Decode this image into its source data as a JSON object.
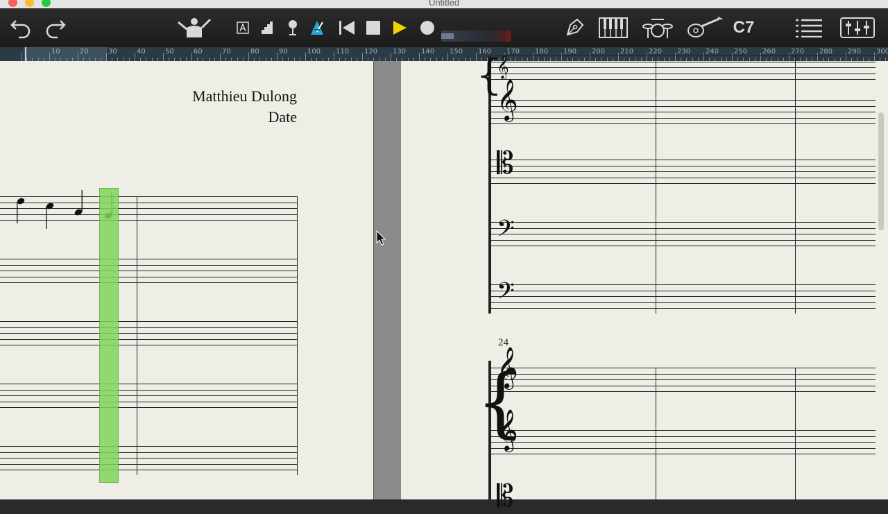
{
  "window": {
    "title": "Untitled"
  },
  "toolbar": {
    "chord_symbol": "C7",
    "meter_level": 0.18
  },
  "ruler": {
    "labels": [
      "10",
      "20",
      "30",
      "40",
      "50",
      "60",
      "70",
      "80",
      "90",
      "100",
      "110",
      "120",
      "130",
      "140",
      "150",
      "160",
      "170",
      "180",
      "190",
      "200",
      "210",
      "220",
      "230",
      "240",
      "250",
      "260",
      "270",
      "280",
      "290",
      "300"
    ]
  },
  "score": {
    "composer": "Matthieu Dulong",
    "date": "Date",
    "measure_number": "24"
  },
  "colors": {
    "toolbar": "#1f1f1f",
    "paper": "#eeeee6",
    "playhead": "#7fd65a",
    "play": "#f4d200",
    "metronome": "#2aa9e0"
  }
}
